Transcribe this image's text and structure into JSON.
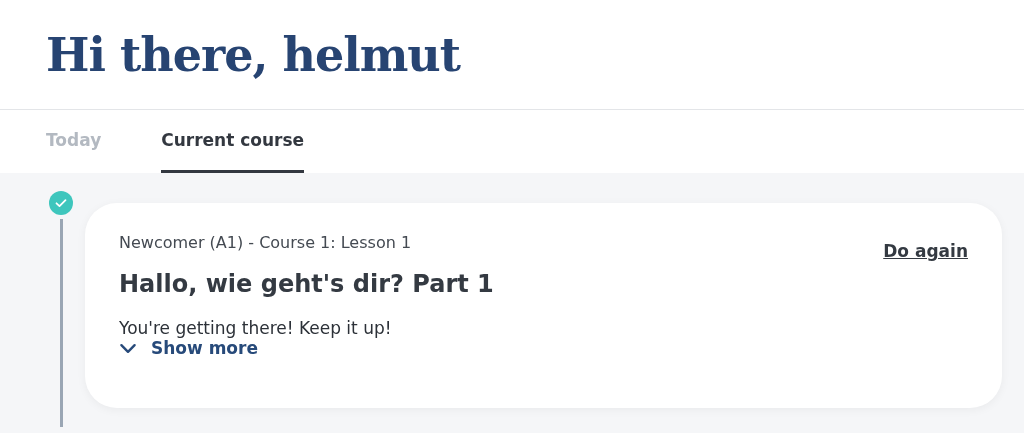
{
  "greeting": "Hi there, helmut",
  "tabs": [
    {
      "label": "Today",
      "selected": false
    },
    {
      "label": "Current course",
      "selected": true
    }
  ],
  "lesson": {
    "completed": true,
    "course": "Newcomer (A1) - Course 1: Lesson 1",
    "title": "Hallo, wie geht's dir? Part 1",
    "message": "You're getting there! Keep it up!",
    "show_more": "Show more",
    "action": "Do again"
  }
}
